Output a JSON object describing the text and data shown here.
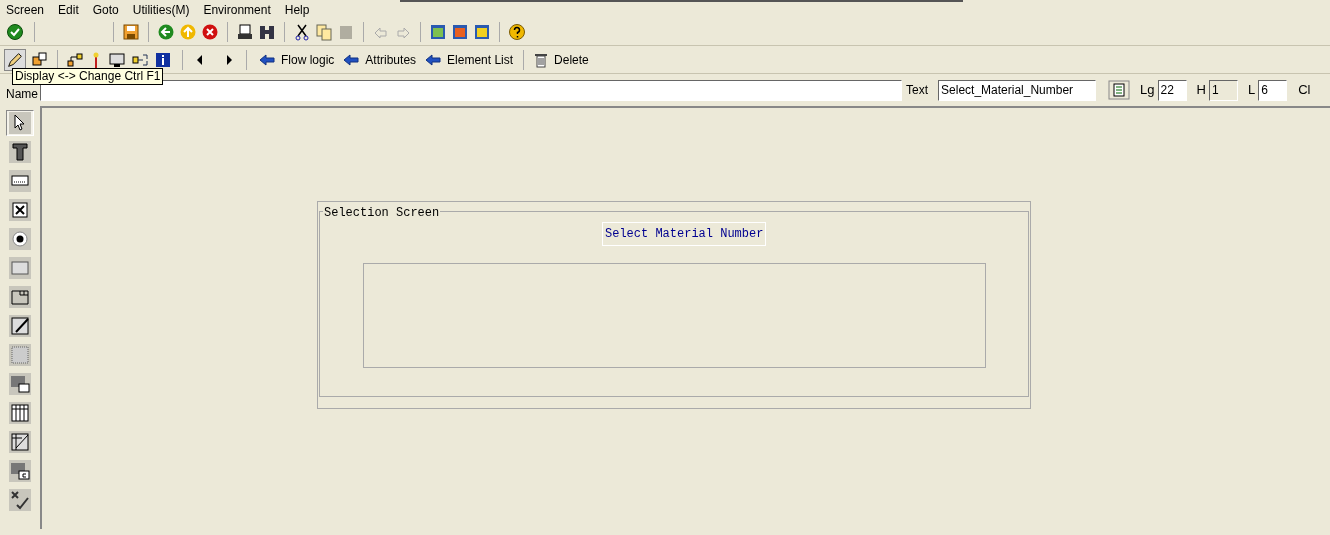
{
  "menu_bar": [
    "Screen",
    "Edit",
    "Goto",
    "Utilities(M)",
    "Environment",
    "Help"
  ],
  "toolbar_buttons": [
    {
      "label": "Flow logic"
    },
    {
      "label": "Attributes"
    },
    {
      "label": "Element List"
    },
    {
      "label": "Delete",
      "kind": "delete"
    }
  ],
  "tooltip": "Display <-> Change Ctrl F1",
  "fields": [
    {
      "label": "Name",
      "disabled": false,
      "kind": "name"
    },
    {
      "label": "Text",
      "value": "Select_Material_Number",
      "disabled": false,
      "kind": "text"
    },
    {
      "label": "Lg",
      "value": "22",
      "disabled": false,
      "kind": "small"
    },
    {
      "label": "H",
      "value": "1",
      "disabled": true,
      "kind": "small"
    },
    {
      "label": "L",
      "value": "6",
      "disabled": false,
      "kind": "small"
    },
    {
      "label": "Cl",
      "kind": "cut"
    }
  ],
  "palette": [
    {
      "selected": true
    },
    {
      "selected": false
    },
    {
      "selected": false
    },
    {
      "selected": false
    },
    {
      "selected": false
    },
    {
      "selected": false
    },
    {
      "selected": false
    },
    {
      "selected": false
    },
    {
      "selected": false
    },
    {
      "selected": false
    },
    {
      "selected": false
    },
    {
      "selected": false
    },
    {
      "selected": false
    },
    {
      "selected": false
    }
  ],
  "canvas": {
    "box_title": "Selection Screen",
    "text_field": "Select Material Number"
  }
}
